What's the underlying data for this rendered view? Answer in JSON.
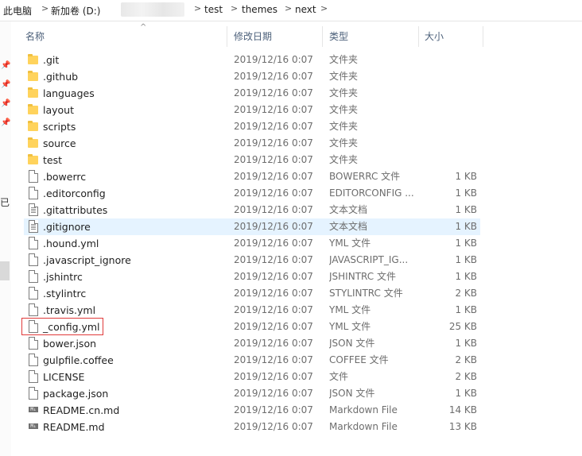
{
  "breadcrumb": {
    "items": [
      "此电脑",
      "新加卷 (D:)",
      "test",
      "themes",
      "next"
    ],
    "separator": ">"
  },
  "left_pane": {
    "char": "已"
  },
  "columns": {
    "name": "名称",
    "modified": "修改日期",
    "type": "类型",
    "size": "大小"
  },
  "files": [
    {
      "name": ".git",
      "date": "2019/12/16 0:07",
      "type": "文件夹",
      "size": "",
      "icon": "folder-icon"
    },
    {
      "name": ".github",
      "date": "2019/12/16 0:07",
      "type": "文件夹",
      "size": "",
      "icon": "folder-icon"
    },
    {
      "name": "languages",
      "date": "2019/12/16 0:07",
      "type": "文件夹",
      "size": "",
      "icon": "folder-icon"
    },
    {
      "name": "layout",
      "date": "2019/12/16 0:07",
      "type": "文件夹",
      "size": "",
      "icon": "folder-icon"
    },
    {
      "name": "scripts",
      "date": "2019/12/16 0:07",
      "type": "文件夹",
      "size": "",
      "icon": "folder-icon"
    },
    {
      "name": "source",
      "date": "2019/12/16 0:07",
      "type": "文件夹",
      "size": "",
      "icon": "folder-icon"
    },
    {
      "name": "test",
      "date": "2019/12/16 0:07",
      "type": "文件夹",
      "size": "",
      "icon": "folder-icon"
    },
    {
      "name": ".bowerrc",
      "date": "2019/12/16 0:07",
      "type": "BOWERRC 文件",
      "size": "1 KB",
      "icon": "file-icon"
    },
    {
      "name": ".editorconfig",
      "date": "2019/12/16 0:07",
      "type": "EDITORCONFIG ...",
      "size": "1 KB",
      "icon": "file-icon"
    },
    {
      "name": ".gitattributes",
      "date": "2019/12/16 0:07",
      "type": "文本文档",
      "size": "1 KB",
      "icon": "text-file-icon"
    },
    {
      "name": ".gitignore",
      "date": "2019/12/16 0:07",
      "type": "文本文档",
      "size": "1 KB",
      "icon": "text-file-icon",
      "selected": true
    },
    {
      "name": ".hound.yml",
      "date": "2019/12/16 0:07",
      "type": "YML 文件",
      "size": "1 KB",
      "icon": "file-icon"
    },
    {
      "name": ".javascript_ignore",
      "date": "2019/12/16 0:07",
      "type": "JAVASCRIPT_IG...",
      "size": "1 KB",
      "icon": "file-icon"
    },
    {
      "name": ".jshintrc",
      "date": "2019/12/16 0:07",
      "type": "JSHINTRC 文件",
      "size": "1 KB",
      "icon": "file-icon"
    },
    {
      "name": ".stylintrc",
      "date": "2019/12/16 0:07",
      "type": "STYLINTRC 文件",
      "size": "2 KB",
      "icon": "file-icon"
    },
    {
      "name": ".travis.yml",
      "date": "2019/12/16 0:07",
      "type": "YML 文件",
      "size": "1 KB",
      "icon": "file-icon"
    },
    {
      "name": "_config.yml",
      "date": "2019/12/16 0:07",
      "type": "YML 文件",
      "size": "25 KB",
      "icon": "file-icon"
    },
    {
      "name": "bower.json",
      "date": "2019/12/16 0:07",
      "type": "JSON 文件",
      "size": "1 KB",
      "icon": "file-icon"
    },
    {
      "name": "gulpfile.coffee",
      "date": "2019/12/16 0:07",
      "type": "COFFEE 文件",
      "size": "2 KB",
      "icon": "file-icon"
    },
    {
      "name": "LICENSE",
      "date": "2019/12/16 0:07",
      "type": "文件",
      "size": "2 KB",
      "icon": "file-icon"
    },
    {
      "name": "package.json",
      "date": "2019/12/16 0:07",
      "type": "JSON 文件",
      "size": "1 KB",
      "icon": "file-icon"
    },
    {
      "name": "README.cn.md",
      "date": "2019/12/16 0:07",
      "type": "Markdown File",
      "size": "14 KB",
      "icon": "markdown-file-icon"
    },
    {
      "name": "README.md",
      "date": "2019/12/16 0:07",
      "type": "Markdown File",
      "size": "13 KB",
      "icon": "markdown-file-icon"
    }
  ],
  "markdown_badge": "M↓",
  "sort_arrow": "^",
  "colors": {
    "selection": "#e5f3ff",
    "highlight_box": "#e03a3a",
    "folder": "#ffd35c",
    "header_text": "#4c607a"
  }
}
